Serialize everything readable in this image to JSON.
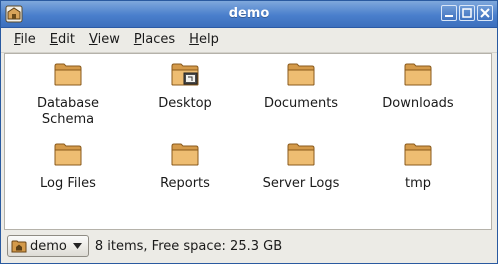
{
  "window": {
    "title": "demo"
  },
  "menubar": {
    "items": [
      {
        "mnemonic": "F",
        "rest": "ile"
      },
      {
        "mnemonic": "E",
        "rest": "dit"
      },
      {
        "mnemonic": "V",
        "rest": "iew"
      },
      {
        "mnemonic": "P",
        "rest": "laces"
      },
      {
        "mnemonic": "H",
        "rest": "elp"
      }
    ]
  },
  "folders": [
    {
      "label_line1": "Database",
      "label_line2": "Schema",
      "icon": "folder-icon"
    },
    {
      "label_line1": "Desktop",
      "label_line2": "",
      "icon": "desktop-folder-icon"
    },
    {
      "label_line1": "Documents",
      "label_line2": "",
      "icon": "folder-icon"
    },
    {
      "label_line1": "Downloads",
      "label_line2": "",
      "icon": "folder-icon"
    },
    {
      "label_line1": "Log Files",
      "label_line2": "",
      "icon": "folder-icon"
    },
    {
      "label_line1": "Reports",
      "label_line2": "",
      "icon": "folder-icon"
    },
    {
      "label_line1": "Server Logs",
      "label_line2": "",
      "icon": "folder-icon"
    },
    {
      "label_line1": "tmp",
      "label_line2": "",
      "icon": "folder-icon"
    }
  ],
  "statusbar": {
    "location": "demo",
    "info": "8 items, Free space: 25.3 GB"
  },
  "colors": {
    "titlebar": "#4a7fcc",
    "folder": "#e9b96e"
  }
}
